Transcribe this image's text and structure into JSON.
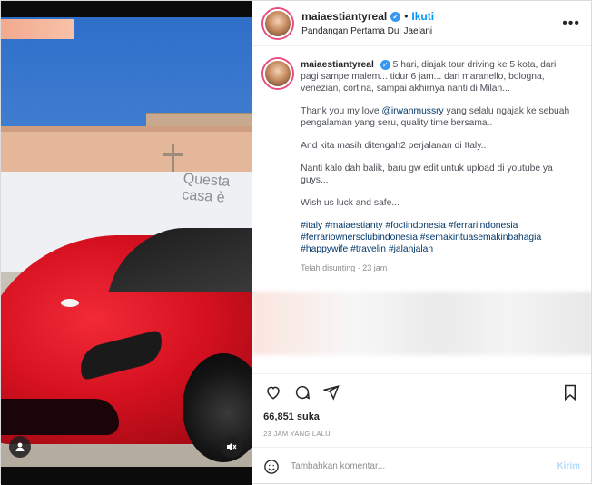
{
  "post": {
    "username": "maiaestiantyreal",
    "follow_label": "Ikuti",
    "header_subtitle": "Pandangan Pertama Dul Jaelani",
    "caption": {
      "line1": "5 hari, diajak tour driving ke 5 kota, dari pagi sampe malem... tidur 6 jam... dari maranello, bologna, venezian, cortina, sampai akhirnya nanti di Milan...",
      "line2_pre": "Thank you my love ",
      "mention": "@irwanmussry",
      "line2_post": " yang selalu ngajak ke sebuah pengalaman yang seru, quality time bersama..",
      "line3": "And kita masih ditengah2 perjalanan di Italy..",
      "line4": "Nanti kalo dah balik, baru gw edit untuk upload di youtube ya guys...",
      "line5": "Wish us luck and safe...",
      "hashtags": "#italy #maiaestianty #focIindonesia #ferrariindonesia #ferrariownersclubindonesia #semakintuasemakinbahagia #happywife #travelin #jalanjalan"
    },
    "edited_meta": "Telah disunting · 23 jam",
    "likes": "66,851 suka",
    "time_ago": "23 JAM YANG LALU",
    "comment_placeholder": "Tambahkan komentar...",
    "post_button": "Kirim",
    "video_wall_text": "Questa casa è"
  },
  "icons": {
    "more": "more-horizontal-icon",
    "like": "heart-icon",
    "comment": "comment-icon",
    "share": "send-icon",
    "save": "bookmark-icon",
    "emoji": "emoji-icon",
    "tags": "user-tag-icon",
    "mute": "speaker-muted-icon"
  },
  "colors": {
    "accent": "#0095f6",
    "verified": "#3897f0",
    "post_disabled": "#b3dbff"
  }
}
